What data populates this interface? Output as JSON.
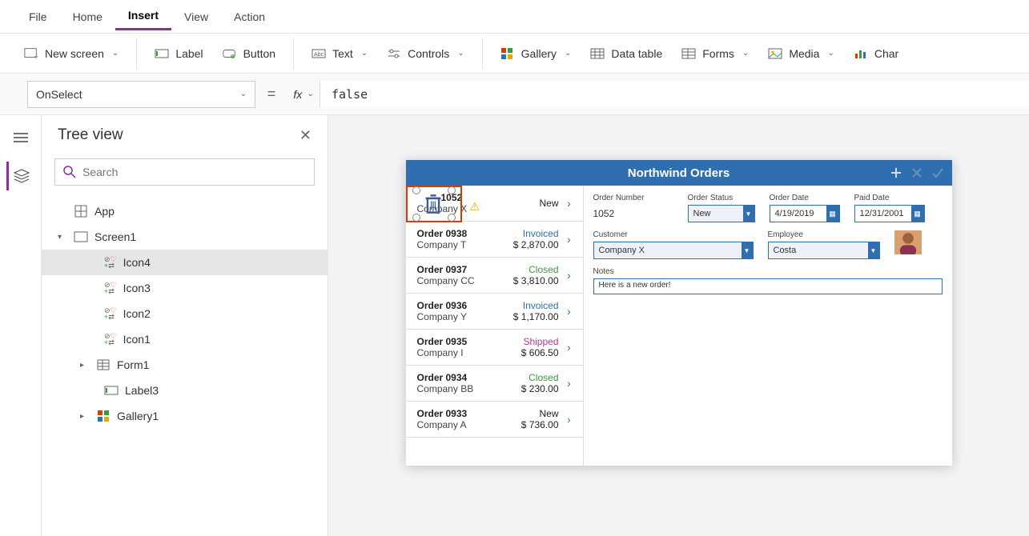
{
  "menubar": [
    "File",
    "Home",
    "Insert",
    "View",
    "Action"
  ],
  "menubar_active": 2,
  "ribbon": {
    "new_screen": "New screen",
    "label": "Label",
    "button": "Button",
    "text": "Text",
    "controls": "Controls",
    "gallery": "Gallery",
    "data_table": "Data table",
    "forms": "Forms",
    "media": "Media",
    "charts": "Char"
  },
  "formula": {
    "property": "OnSelect",
    "fx": "fx",
    "value": "false"
  },
  "tree": {
    "title": "Tree view",
    "search_placeholder": "Search",
    "app": "App",
    "screen": "Screen1",
    "nodes": [
      "Icon4",
      "Icon3",
      "Icon2",
      "Icon1",
      "Form1",
      "Label3",
      "Gallery1"
    ],
    "selected": "Icon4"
  },
  "preview": {
    "title": "Northwind Orders",
    "orders": [
      {
        "title": "1052",
        "company": "Company X",
        "status": "New",
        "amount": ""
      },
      {
        "title": "Order 0938",
        "company": "Company T",
        "status": "Invoiced",
        "amount": "$ 2,870.00"
      },
      {
        "title": "Order 0937",
        "company": "Company CC",
        "status": "Closed",
        "amount": "$ 3,810.00"
      },
      {
        "title": "Order 0936",
        "company": "Company Y",
        "status": "Invoiced",
        "amount": "$ 1,170.00"
      },
      {
        "title": "Order 0935",
        "company": "Company I",
        "status": "Shipped",
        "amount": "$ 606.50"
      },
      {
        "title": "Order 0934",
        "company": "Company BB",
        "status": "Closed",
        "amount": "$ 230.00"
      },
      {
        "title": "Order 0933",
        "company": "Company A",
        "status": "New",
        "amount": "$ 736.00"
      }
    ],
    "form": {
      "labels": {
        "order_number": "Order Number",
        "order_status": "Order Status",
        "order_date": "Order Date",
        "paid_date": "Paid Date",
        "customer": "Customer",
        "employee": "Employee",
        "notes": "Notes"
      },
      "values": {
        "order_number": "1052",
        "order_status": "New",
        "order_date": "4/19/2019",
        "paid_date": "12/31/2001",
        "customer": "Company X",
        "employee": "Costa",
        "notes": "Here is a new order!"
      }
    }
  }
}
